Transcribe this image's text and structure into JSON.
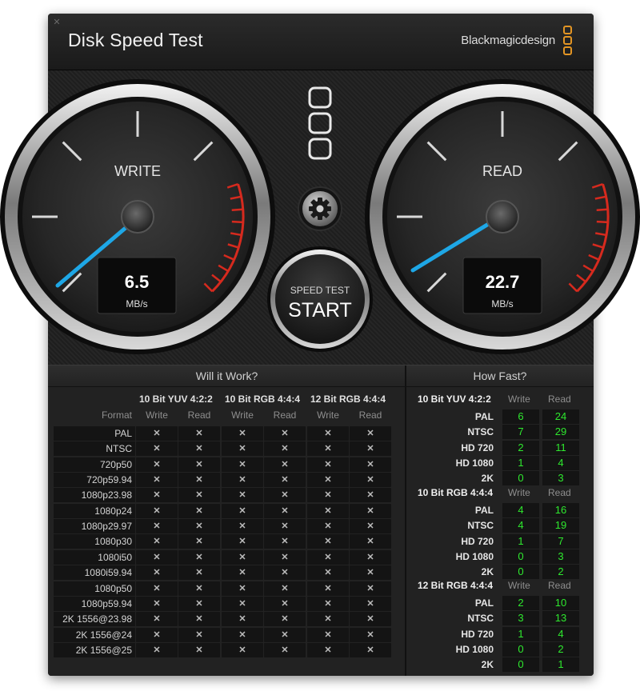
{
  "app": {
    "title": "Disk Speed Test",
    "brand": "Blackmagicdesign",
    "close_glyph": "✕"
  },
  "gauges": {
    "write": {
      "label": "WRITE",
      "value": "6.5",
      "unit": "MB/s"
    },
    "read": {
      "label": "READ",
      "value": "22.7",
      "unit": "MB/s"
    }
  },
  "controls": {
    "settings_icon": "gear-icon",
    "start_top": "SPEED TEST",
    "start_main": "START"
  },
  "will": {
    "title": "Will it Work?",
    "format_label": "Format",
    "groups": [
      "10 Bit YUV 4:2:2",
      "10 Bit RGB 4:4:4",
      "12 Bit RGB 4:4:4"
    ],
    "write_label": "Write",
    "read_label": "Read",
    "cross": "✕",
    "formats": [
      "PAL",
      "NTSC",
      "720p50",
      "720p59.94",
      "1080p23.98",
      "1080p24",
      "1080p29.97",
      "1080p30",
      "1080i50",
      "1080i59.94",
      "1080p50",
      "1080p59.94",
      "2K 1556@23.98",
      "2K 1556@24",
      "2K 1556@25"
    ]
  },
  "fast": {
    "title": "How Fast?",
    "write_label": "Write",
    "read_label": "Read",
    "groups": [
      {
        "name": "10 Bit YUV 4:2:2",
        "rows": [
          {
            "format": "PAL",
            "write": "6",
            "read": "24"
          },
          {
            "format": "NTSC",
            "write": "7",
            "read": "29"
          },
          {
            "format": "HD 720",
            "write": "2",
            "read": "11"
          },
          {
            "format": "HD 1080",
            "write": "1",
            "read": "4"
          },
          {
            "format": "2K",
            "write": "0",
            "read": "3"
          }
        ]
      },
      {
        "name": "10 Bit RGB 4:4:4",
        "rows": [
          {
            "format": "PAL",
            "write": "4",
            "read": "16"
          },
          {
            "format": "NTSC",
            "write": "4",
            "read": "19"
          },
          {
            "format": "HD 720",
            "write": "1",
            "read": "7"
          },
          {
            "format": "HD 1080",
            "write": "0",
            "read": "3"
          },
          {
            "format": "2K",
            "write": "0",
            "read": "2"
          }
        ]
      },
      {
        "name": "12 Bit RGB 4:4:4",
        "rows": [
          {
            "format": "PAL",
            "write": "2",
            "read": "10"
          },
          {
            "format": "NTSC",
            "write": "3",
            "read": "13"
          },
          {
            "format": "HD 720",
            "write": "1",
            "read": "4"
          },
          {
            "format": "HD 1080",
            "write": "0",
            "read": "2"
          },
          {
            "format": "2K",
            "write": "0",
            "read": "1"
          }
        ]
      }
    ]
  },
  "colors": {
    "accent_needle": "#1ea7e6",
    "redline": "#d62a1e",
    "fast_value": "#2ee82e",
    "brand_logo": "#e39524"
  }
}
